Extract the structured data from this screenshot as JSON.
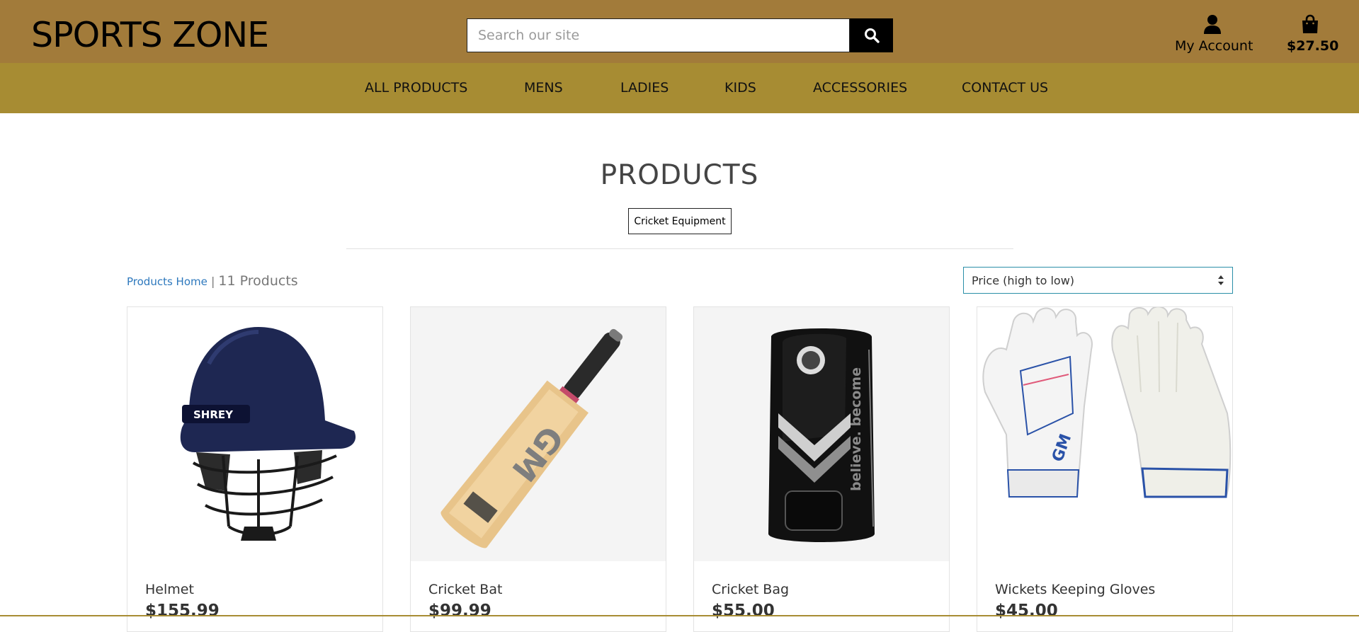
{
  "header": {
    "logo": "SPORTS ZONE",
    "search_placeholder": "Search our site",
    "account_label": "My Account",
    "bag_total": "$27.50"
  },
  "nav": {
    "items": [
      "ALL PRODUCTS",
      "MENS",
      "LADIES",
      "KIDS",
      "ACCESSORIES",
      "CONTACT US"
    ]
  },
  "page": {
    "title": "PRODUCTS",
    "category": "Cricket Equipment",
    "breadcrumb_link": "Products Home",
    "separator": "|",
    "product_count": "11 Products",
    "sort_value": "Price (high to low)"
  },
  "products": [
    {
      "name": "Helmet",
      "price": "$155.99",
      "image": "cricket-helmet"
    },
    {
      "name": "Cricket Bat",
      "price": "$99.99",
      "image": "cricket-bat"
    },
    {
      "name": "Cricket Bag",
      "price": "$55.00",
      "image": "cricket-bag"
    },
    {
      "name": "Wickets Keeping Gloves",
      "price": "$45.00",
      "image": "keeping-gloves"
    }
  ],
  "product_image_text": {
    "helmet_brand": "SHREY",
    "bat_brand": "GM",
    "bag_text": "believe. become",
    "gloves_brand": "GM"
  },
  "colors": {
    "header_bg": "#a27b3a",
    "nav_bg": "#a78c33",
    "link": "#2d78bd",
    "sort_border": "#2a8fa8"
  }
}
